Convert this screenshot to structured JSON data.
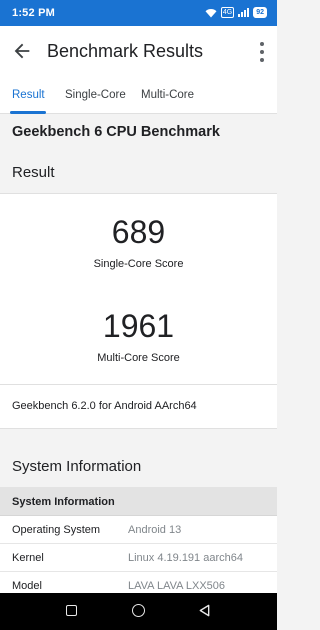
{
  "status_bar": {
    "time": "1:52 PM",
    "sig_label": "4G",
    "battery": "92"
  },
  "app_bar": {
    "title": "Benchmark Results"
  },
  "tabs": [
    {
      "label": "Result",
      "active": true
    },
    {
      "label": "Single-Core",
      "active": false
    },
    {
      "label": "Multi-Core",
      "active": false
    }
  ],
  "benchmark_title": "Geekbench 6 CPU Benchmark",
  "result_heading": "Result",
  "scores": {
    "single_core": {
      "value": "689",
      "label": "Single-Core Score"
    },
    "multi_core": {
      "value": "1961",
      "label": "Multi-Core Score"
    }
  },
  "version_text": "Geekbench 6.2.0 for Android AArch64",
  "system_info": {
    "heading": "System Information",
    "table_header": "System Information",
    "rows": [
      {
        "key": "Operating System",
        "value": "Android 13"
      },
      {
        "key": "Kernel",
        "value": "Linux 4.19.191 aarch64"
      },
      {
        "key": "Model",
        "value": "LAVA LAVA LXX506"
      }
    ]
  },
  "colors": {
    "accent": "#1a73d2",
    "nav_bar": "#000000"
  }
}
